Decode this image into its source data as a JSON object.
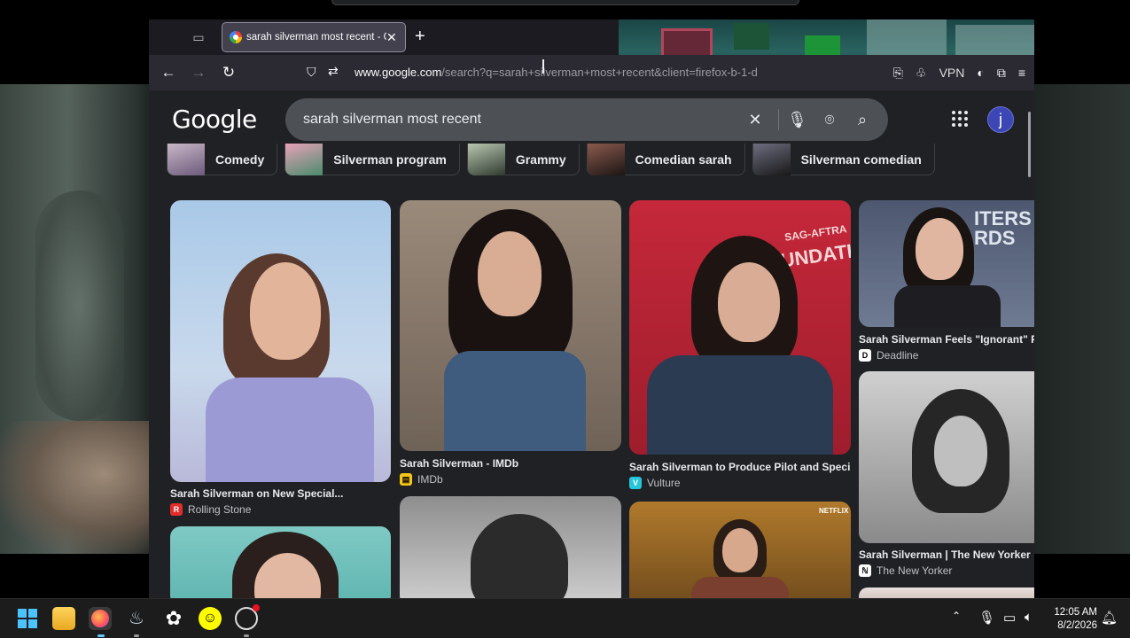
{
  "browser": {
    "tab_title": "sarah silverman most recent - G",
    "url_domain": "www.google.com",
    "url_path": "/search?q=sarah+silverman+most+recent&client=firefox-b-1-d",
    "vpn_label": "VPN"
  },
  "search": {
    "logo": "Google",
    "query": "sarah silverman most recent",
    "avatar_letter": "j"
  },
  "chips": [
    {
      "label": "Comedy"
    },
    {
      "label": "Silverman program"
    },
    {
      "label": "Grammy"
    },
    {
      "label": "Comedian sarah"
    },
    {
      "label": "Silverman comedian"
    }
  ],
  "results": [
    {
      "caption": "Sarah Silverman on New Special...",
      "source": "Rolling Stone"
    },
    {
      "caption": "Sarah Silverman - IMDb",
      "source": "IMDb"
    },
    {
      "caption": "Sarah Silverman to Produce Pilot and Speci...",
      "source": "Vulture"
    },
    {
      "caption": "Sarah Silverman Feels \"Ignorant\" For...",
      "source": "Deadline"
    },
    {
      "caption": "Sarah Silverman | The New Yorker",
      "source": "The New Yorker"
    }
  ],
  "image_text": {
    "foundation": "FOUNDATION",
    "sag_aftra": "SAG-AFTRA",
    "netflix": "NETFLIX"
  },
  "taskbar": {
    "time": "12:05 AM",
    "date": "8/2/2026"
  },
  "colors": {
    "page_bg": "#202124",
    "searchbox_bg": "#4d5156",
    "avatar_bg": "#3c47b5"
  }
}
